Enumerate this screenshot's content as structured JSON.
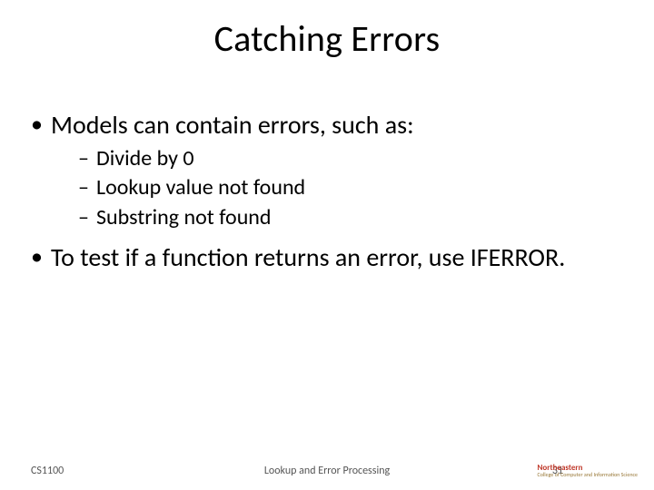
{
  "title": "Catching Errors",
  "bullets": {
    "b1": {
      "text": "Models can contain errors, such as:",
      "sub": {
        "s1": "Divide by 0",
        "s2": "Lookup value not found",
        "s3": "Substring not found"
      }
    },
    "b2": {
      "text": "To test if a function returns an error, use IFERROR."
    }
  },
  "footer": {
    "left": "CS1100",
    "center": "Lookup and Error Processing",
    "page": "31",
    "logo_top": "Northeastern",
    "logo_bottom": "College of Computer and Information Science"
  }
}
